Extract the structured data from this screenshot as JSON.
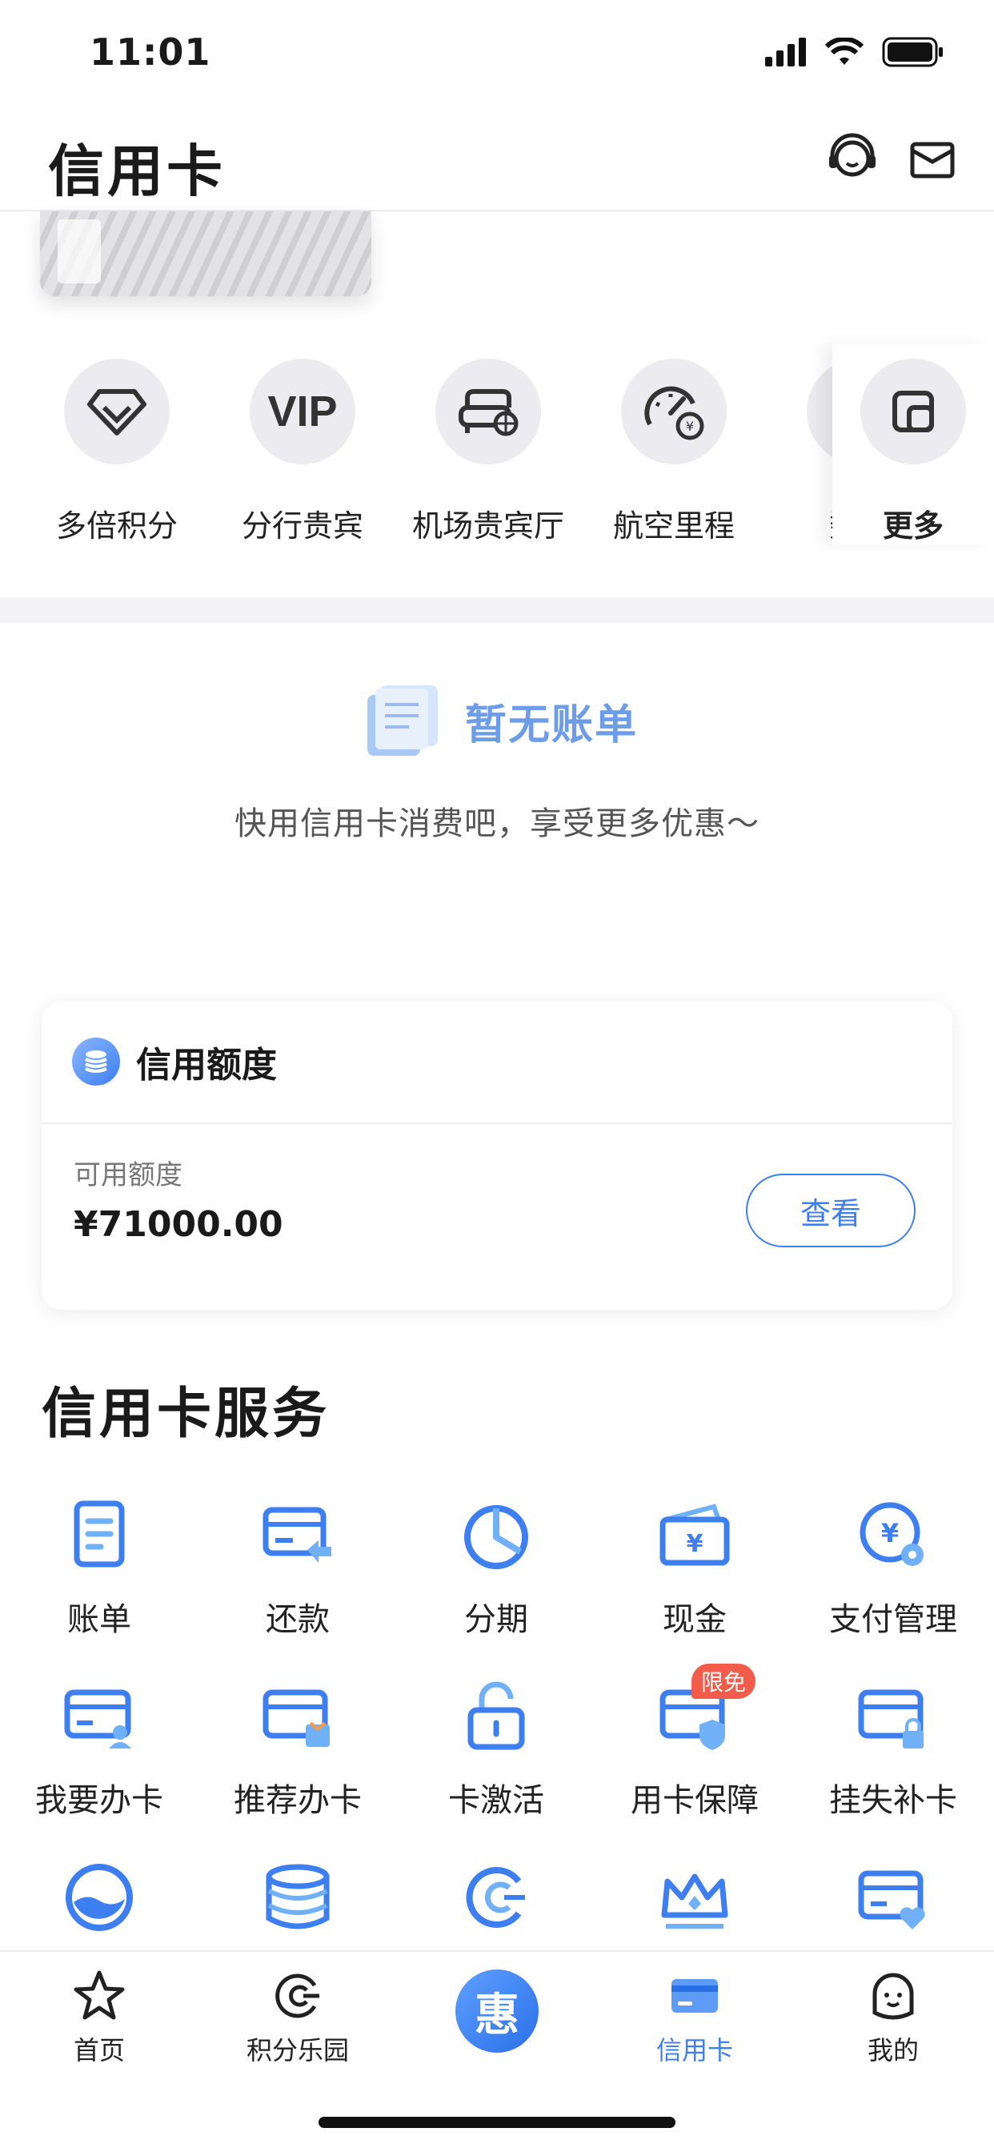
{
  "status": {
    "time": "11:01"
  },
  "header": {
    "title": "信用卡"
  },
  "perks": [
    {
      "label": "多倍积分",
      "icon": "diamond-icon"
    },
    {
      "label": "分行贵宾",
      "icon": "vip-icon",
      "icon_text": "VIP"
    },
    {
      "label": "机场贵宾厅",
      "icon": "lounge-sofa-icon"
    },
    {
      "label": "航空里程",
      "icon": "gauge-yen-icon"
    },
    {
      "label": "数字",
      "icon": "digital-icon"
    }
  ],
  "perks_more": {
    "label": "更多",
    "icon": "more-grid-icon"
  },
  "empty_bill": {
    "title": "暂无账单",
    "subtitle": "快用信用卡消费吧，享受更多优惠～"
  },
  "credit_limit": {
    "title": "信用额度",
    "available_label": "可用额度",
    "amount": "¥71000.00",
    "view_button": "查看"
  },
  "services": {
    "title": "信用卡服务",
    "items": [
      {
        "label": "账单",
        "icon": "bill-doc-icon"
      },
      {
        "label": "还款",
        "icon": "repay-card-icon"
      },
      {
        "label": "分期",
        "icon": "pie-chart-icon"
      },
      {
        "label": "现金",
        "icon": "cash-wallet-icon"
      },
      {
        "label": "支付管理",
        "icon": "payment-settings-icon"
      },
      {
        "label": "我要办卡",
        "icon": "apply-card-icon"
      },
      {
        "label": "推荐办卡",
        "icon": "recommend-card-icon"
      },
      {
        "label": "卡激活",
        "icon": "unlock-icon"
      },
      {
        "label": "用卡保障",
        "icon": "card-shield-icon",
        "badge": "限免"
      },
      {
        "label": "挂失补卡",
        "icon": "card-lock-icon"
      }
    ]
  },
  "tabbar": {
    "items": [
      {
        "label": "首页",
        "icon": "star-icon",
        "active": false
      },
      {
        "label": "积分乐园",
        "icon": "points-c-icon",
        "active": false
      },
      {
        "label": "信用卡",
        "icon": "credit-card-icon",
        "active": true
      },
      {
        "label": "我的",
        "icon": "profile-face-icon",
        "active": false
      }
    ],
    "center_glyph": "惠"
  },
  "colors": {
    "accent": "#3d7ff0",
    "empty_title": "#6d9de8",
    "badge": "#f35b4b"
  }
}
